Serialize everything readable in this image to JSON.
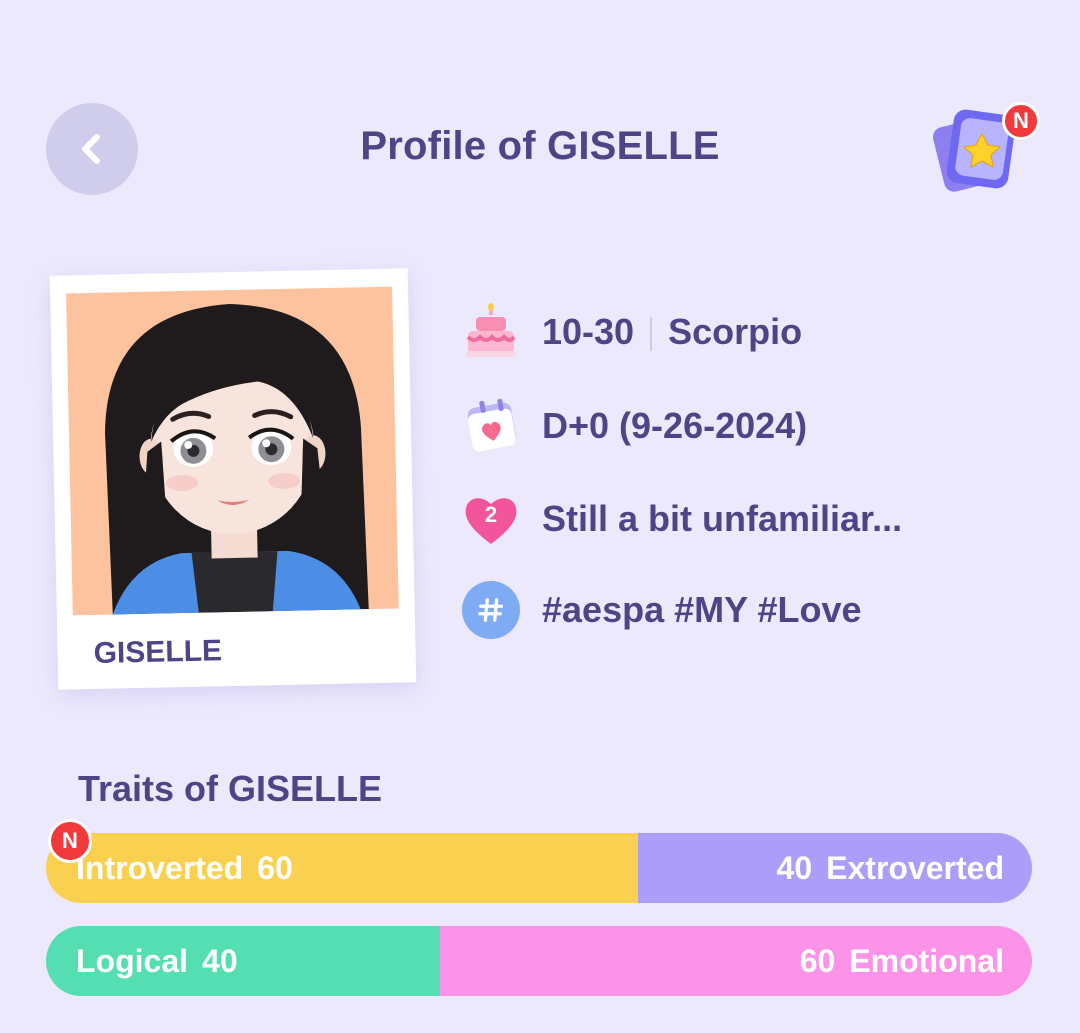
{
  "header": {
    "title": "Profile of GISELLE",
    "new_badge": "N"
  },
  "profile": {
    "name": "GISELLE",
    "birthday": "10-30",
    "zodiac": "Scorpio",
    "dday": "D+0 (9-26-2024)",
    "relationship_level": "2",
    "relationship_text": "Still a bit unfamiliar...",
    "tags": "#aespa #MY #Love"
  },
  "traits": {
    "title": "Traits of GISELLE",
    "new_badge": "N",
    "bars": [
      {
        "left_label": "Introverted",
        "left_value": 60,
        "right_label": "Extroverted",
        "right_value": 40,
        "left_color": "#f9d04f",
        "right_color": "#ac9ef8"
      },
      {
        "left_label": "Logical",
        "left_value": 40,
        "right_label": "Emotional",
        "right_value": 60,
        "left_color": "#54deb1",
        "right_color": "#fb93e8"
      }
    ]
  },
  "icons": {
    "back": "chevron-left-icon",
    "cards": "star-cards-icon",
    "birthday": "birthday-cake-icon",
    "dday": "calendar-heart-icon",
    "relationship": "heart-icon",
    "tags": "hashtag-icon"
  },
  "colors": {
    "background": "#ece9fd",
    "text": "#4d4585",
    "badge": "#f2393c"
  }
}
